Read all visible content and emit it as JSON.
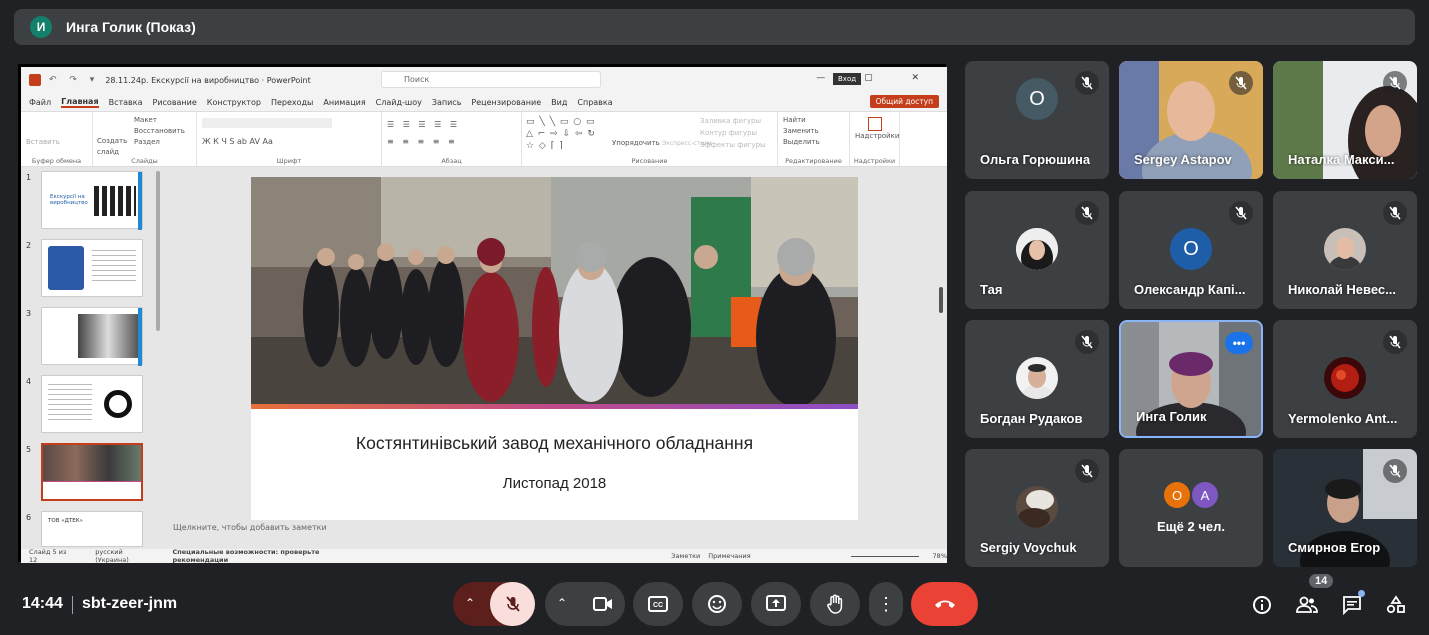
{
  "topbar": {
    "avatar_letter": "И",
    "presenter": "Инга Голик (Показ)"
  },
  "ppt": {
    "quick_access": "↶ ↷ ▾",
    "document_title": "28.11.24р. Екскурсії на виробництво  ·  PowerPoint",
    "search_placeholder": "Поиск",
    "login": "Вход",
    "window_controls": "— ▢ ✕",
    "menu": [
      "Файл",
      "Главная",
      "Вставка",
      "Рисование",
      "Конструктор",
      "Переходы",
      "Анимация",
      "Слайд-шоу",
      "Запись",
      "Рецензирование",
      "Вид",
      "Справка"
    ],
    "share_button": "Общий доступ",
    "ribbon": {
      "clipboard": {
        "label": "Буфер обмена",
        "paste": "Вставить"
      },
      "slides": {
        "label": "Слайды",
        "new_slide": "Создать слайд",
        "layout": "Макет",
        "reset": "Восстановить",
        "section": "Раздел"
      },
      "font": {
        "label": "Шрифт",
        "format_row": "Ж  К  Ч  S  ab  AV  Aa"
      },
      "paragraph": {
        "label": "Абзац"
      },
      "drawing": {
        "label": "Рисование",
        "arrange": "Упорядочить",
        "quick_styles": "Экспресс-стили",
        "fill": "Заливка фигуры",
        "outline": "Контур фигуры",
        "effects": "Эффекты фигуры"
      },
      "editing": {
        "label": "Редактирование",
        "find": "Найти",
        "replace": "Заменить",
        "select": "Выделить"
      },
      "addins": {
        "label": "Надстройки",
        "addins": "Надстройки"
      }
    },
    "thumbnails": [
      {
        "num": "1",
        "text": "Екскурсії на виробництво"
      },
      {
        "num": "2",
        "text": ""
      },
      {
        "num": "3",
        "text": ""
      },
      {
        "num": "4",
        "text": ""
      },
      {
        "num": "5",
        "text": ""
      },
      {
        "num": "6",
        "text": "ТОВ «ДТЕК»"
      }
    ],
    "slide": {
      "title": "Костянтинівський завод механічного обладнання",
      "subtitle": "Листопад 2018"
    },
    "notes_placeholder": "Щелкните, чтобы добавить заметки",
    "status": {
      "slide_count": "Слайд 5 из 12",
      "language": "русский (Украина)",
      "accessibility": "Специальные возможности: проверьте рекомендации",
      "notes": "Заметки",
      "comments": "Примечания",
      "zoom": "78%"
    }
  },
  "participants": [
    {
      "name": "Ольга Горюшина",
      "avatar_letter": "О",
      "avatar_color": "#455a64",
      "type": "letter"
    },
    {
      "name": "Sergey Astapov",
      "type": "video"
    },
    {
      "name": "Наталка Макси...",
      "type": "video"
    },
    {
      "name": "Тая",
      "type": "photo"
    },
    {
      "name": "Олександр Капі...",
      "avatar_letter": "О",
      "avatar_color": "#1e5ea8",
      "type": "letter"
    },
    {
      "name": "Николай Невес...",
      "type": "photo"
    },
    {
      "name": "Богдан Рудаков",
      "type": "photo"
    },
    {
      "name": "Инга Голик",
      "type": "video",
      "active": true
    },
    {
      "name": "Yermolenko Ant...",
      "type": "photo"
    },
    {
      "name": "Sergiy Voychuk",
      "type": "photo"
    },
    {
      "name": "Ещё 2 чел.",
      "letters": [
        "О",
        "А"
      ],
      "colors": [
        "#e8710a",
        "#7e57c2"
      ],
      "type": "more"
    },
    {
      "name": "Смирнов Егор",
      "type": "video"
    }
  ],
  "bottom": {
    "time": "14:44",
    "meeting_code": "sbt-zeer-jnm",
    "participants_count": "14",
    "colors": {
      "end_call": "#ea4335",
      "mic_off": "#f9dedc",
      "mic_group": "#5c1f1b"
    }
  }
}
